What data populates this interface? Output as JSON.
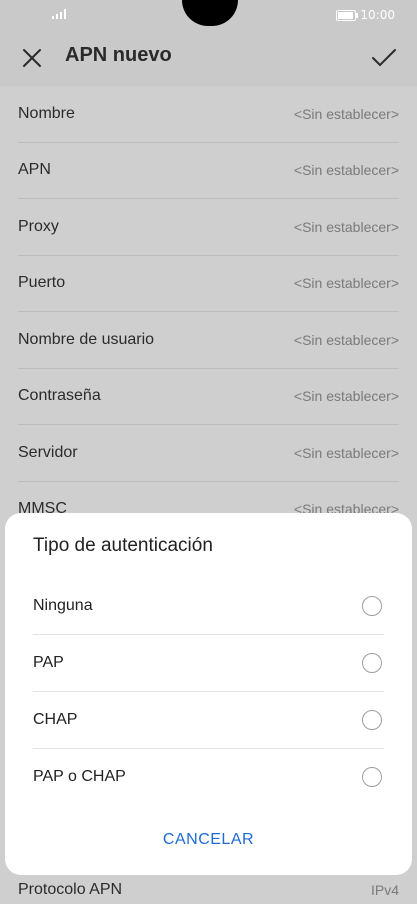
{
  "status_bar": {
    "time": "10:00",
    "icons": [
      "signal-icon",
      "battery-icon"
    ]
  },
  "app_bar": {
    "title": "APN nuevo",
    "left_icon": "close-icon",
    "right_icon": "check-icon"
  },
  "settings": [
    {
      "label": "Nombre",
      "value": "<Sin establecer>"
    },
    {
      "label": "APN",
      "value": "<Sin establecer>"
    },
    {
      "label": "Proxy",
      "value": "<Sin establecer>"
    },
    {
      "label": "Puerto",
      "value": "<Sin establecer>"
    },
    {
      "label": "Nombre de usuario",
      "value": "<Sin establecer>"
    },
    {
      "label": "Contraseña",
      "value": "<Sin establecer>"
    },
    {
      "label": "Servidor",
      "value": "<Sin establecer>"
    },
    {
      "label": "MMSC",
      "value": "<Sin establecer>"
    }
  ],
  "bottom_setting": {
    "label": "Protocolo APN",
    "value": "IPv4"
  },
  "dialog": {
    "title": "Tipo de autenticación",
    "options": [
      "Ninguna",
      "PAP",
      "CHAP",
      "PAP o CHAP"
    ],
    "cancel_label": "CANCELAR"
  },
  "colors": {
    "accent": "#1e6bd6",
    "overlay": "#cfcfcf",
    "dialog": "#ffffff"
  }
}
